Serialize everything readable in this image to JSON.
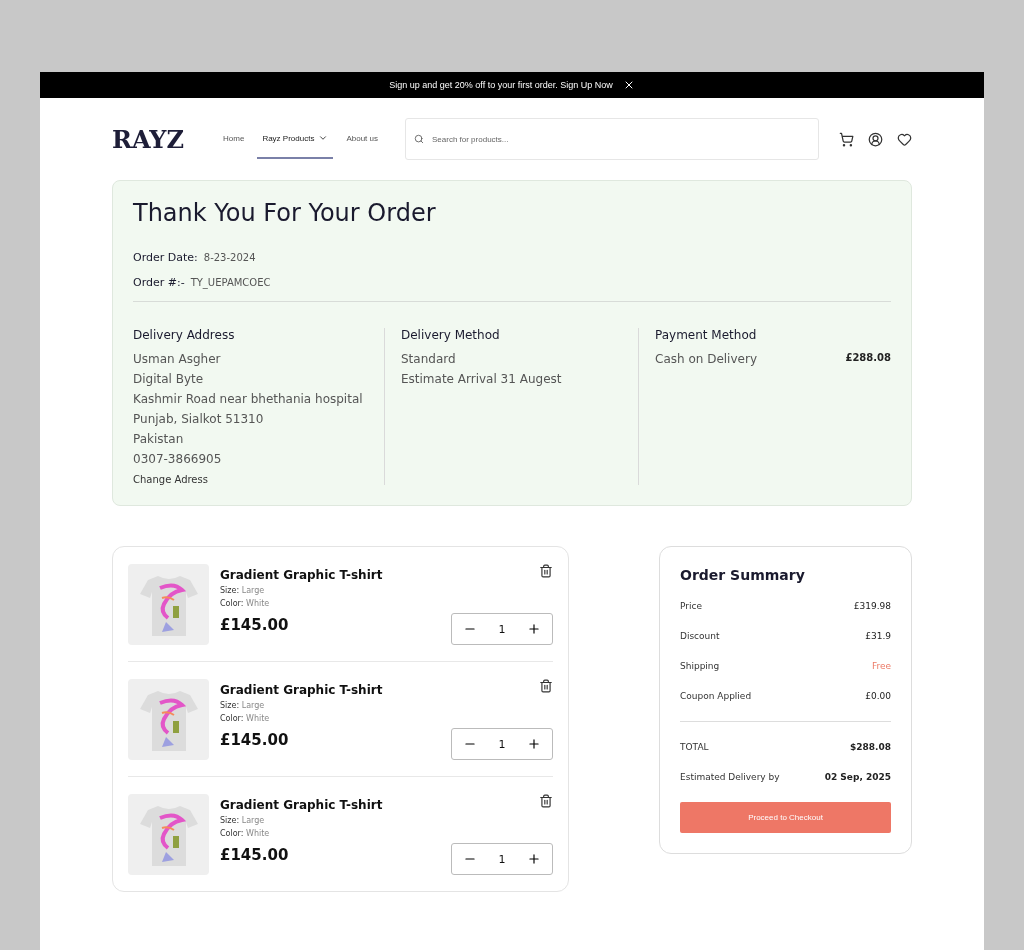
{
  "promo_bar": {
    "text": "Sign up and get 20% off to your first order. Sign Up Now"
  },
  "header": {
    "logo": "RAYZ",
    "nav": [
      {
        "label": "Home",
        "selected": false,
        "dropdown": false
      },
      {
        "label": "Rayz Products",
        "selected": true,
        "dropdown": true
      },
      {
        "label": "About us",
        "selected": false,
        "dropdown": false
      }
    ],
    "search": {
      "placeholder": "Search for products..."
    }
  },
  "confirmation": {
    "title": "Thank You For Your Order",
    "meta": [
      {
        "label": "Order Date:",
        "value": "8-23-2024"
      },
      {
        "label": "Order #:-",
        "value": "TY_UEPAMCOEC"
      }
    ],
    "address": {
      "heading": "Delivery Address",
      "lines": [
        "Usman Asgher",
        "Digital Byte",
        "Kashmir Road near bhethania hospital",
        "Punjab, Sialkot 51310",
        "Pakistan",
        "0307-3866905"
      ],
      "link": "Change Adress"
    },
    "delivery": {
      "heading": "Delivery Method",
      "lines": [
        "Standard",
        "Estimate Arrival 31 Augest"
      ]
    },
    "payment": {
      "heading": "Payment Method",
      "method": "Cash on Delivery",
      "amount": "£288.08"
    }
  },
  "cart_items": [
    {
      "name": "Gradient Graphic T-shirt",
      "size_label": "Size:",
      "size": "Large",
      "color_label": "Color:",
      "color_name": "White",
      "price": "£145.00",
      "quantity": "1"
    },
    {
      "name": "Gradient Graphic T-shirt",
      "size_label": "Size:",
      "size": "Large",
      "color_label": "Color:",
      "color_name": "White",
      "price": "£145.00",
      "quantity": "1"
    },
    {
      "name": "Gradient Graphic T-shirt",
      "size_label": "Size:",
      "size": "Large",
      "color_label": "Color:",
      "color_name": "White",
      "price": "£145.00",
      "quantity": "1"
    }
  ],
  "order_summary": {
    "title": "Order Summary",
    "rows": [
      {
        "label": "Price",
        "value": "£319.98",
        "highlight": false
      },
      {
        "label": "Discount",
        "value": "£31.9",
        "highlight": false
      },
      {
        "label": "Shipping",
        "value": "Free",
        "highlight": true
      },
      {
        "label": "Coupon Applied",
        "value": "£0.00",
        "highlight": false
      }
    ],
    "totals": [
      {
        "label": "TOTAL",
        "value": "$288.08"
      },
      {
        "label": "Estimated Delivery by",
        "value": "02 Sep, 2025"
      }
    ],
    "button": "Proceed to Checkout"
  }
}
